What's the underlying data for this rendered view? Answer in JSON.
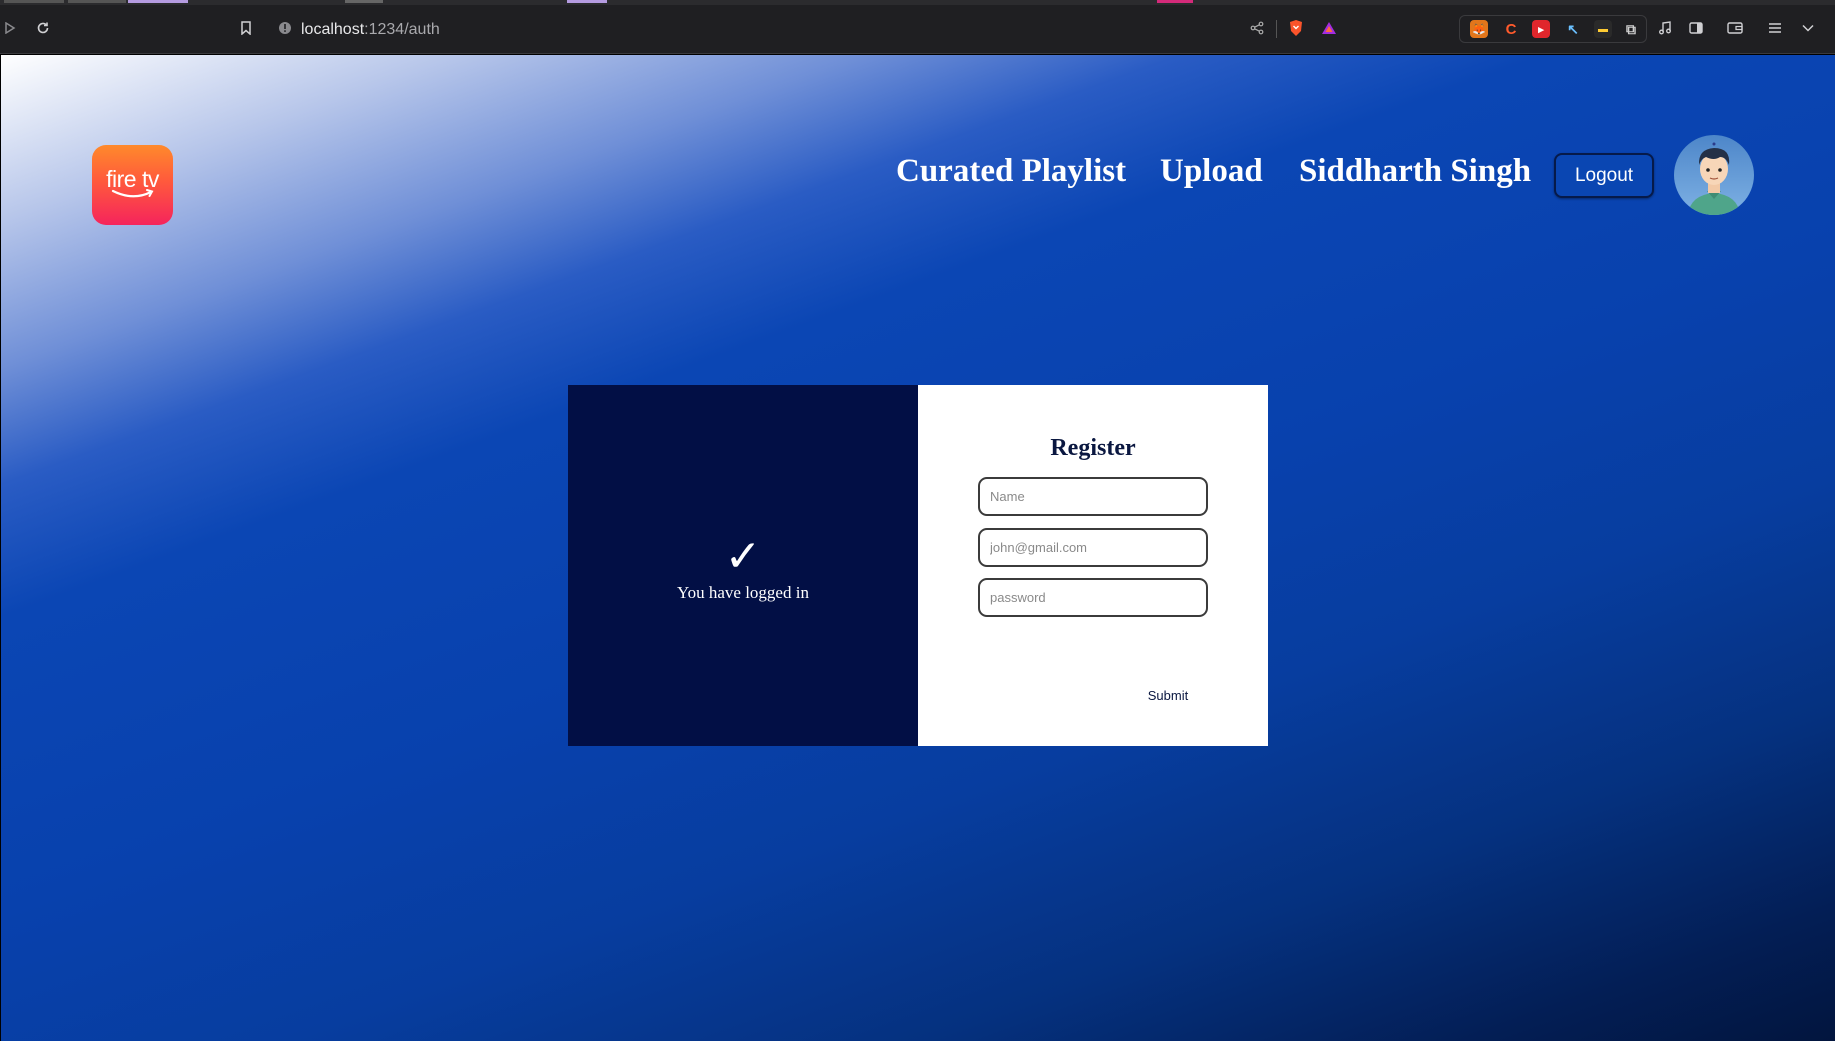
{
  "browser": {
    "url_host": "localhost",
    "url_path": ":1234/auth",
    "icons": [
      "play-icon",
      "reload-icon",
      "bookmark-icon",
      "site-info-icon",
      "share-icon",
      "brave-shield-icon",
      "brave-rewards-icon",
      "metamask-icon",
      "extension-c-icon",
      "youtube-extension-icon",
      "cursor-extension-icon",
      "dark-extension-icon",
      "puzzle-icon",
      "music-icon",
      "sidebar-icon",
      "wallet-icon",
      "menu-icon",
      "chevron-down-icon"
    ]
  },
  "header": {
    "logo_text": "fire tv",
    "nav": [
      "Curated Playlist",
      "Upload",
      "Siddharth Singh"
    ],
    "logout_label": "Logout"
  },
  "status_panel": {
    "icon": "✓",
    "message": "You have logged in"
  },
  "register": {
    "title": "Register",
    "name_placeholder": "Name",
    "email_placeholder": "john@gmail.com",
    "password_placeholder": "password",
    "submit_label": "Submit"
  },
  "colors": {
    "panel_dark": "#020f45",
    "accent_blue": "#0841ad",
    "logo_gradient_top": "#ff8a2b",
    "logo_gradient_bottom": "#f5245c"
  }
}
